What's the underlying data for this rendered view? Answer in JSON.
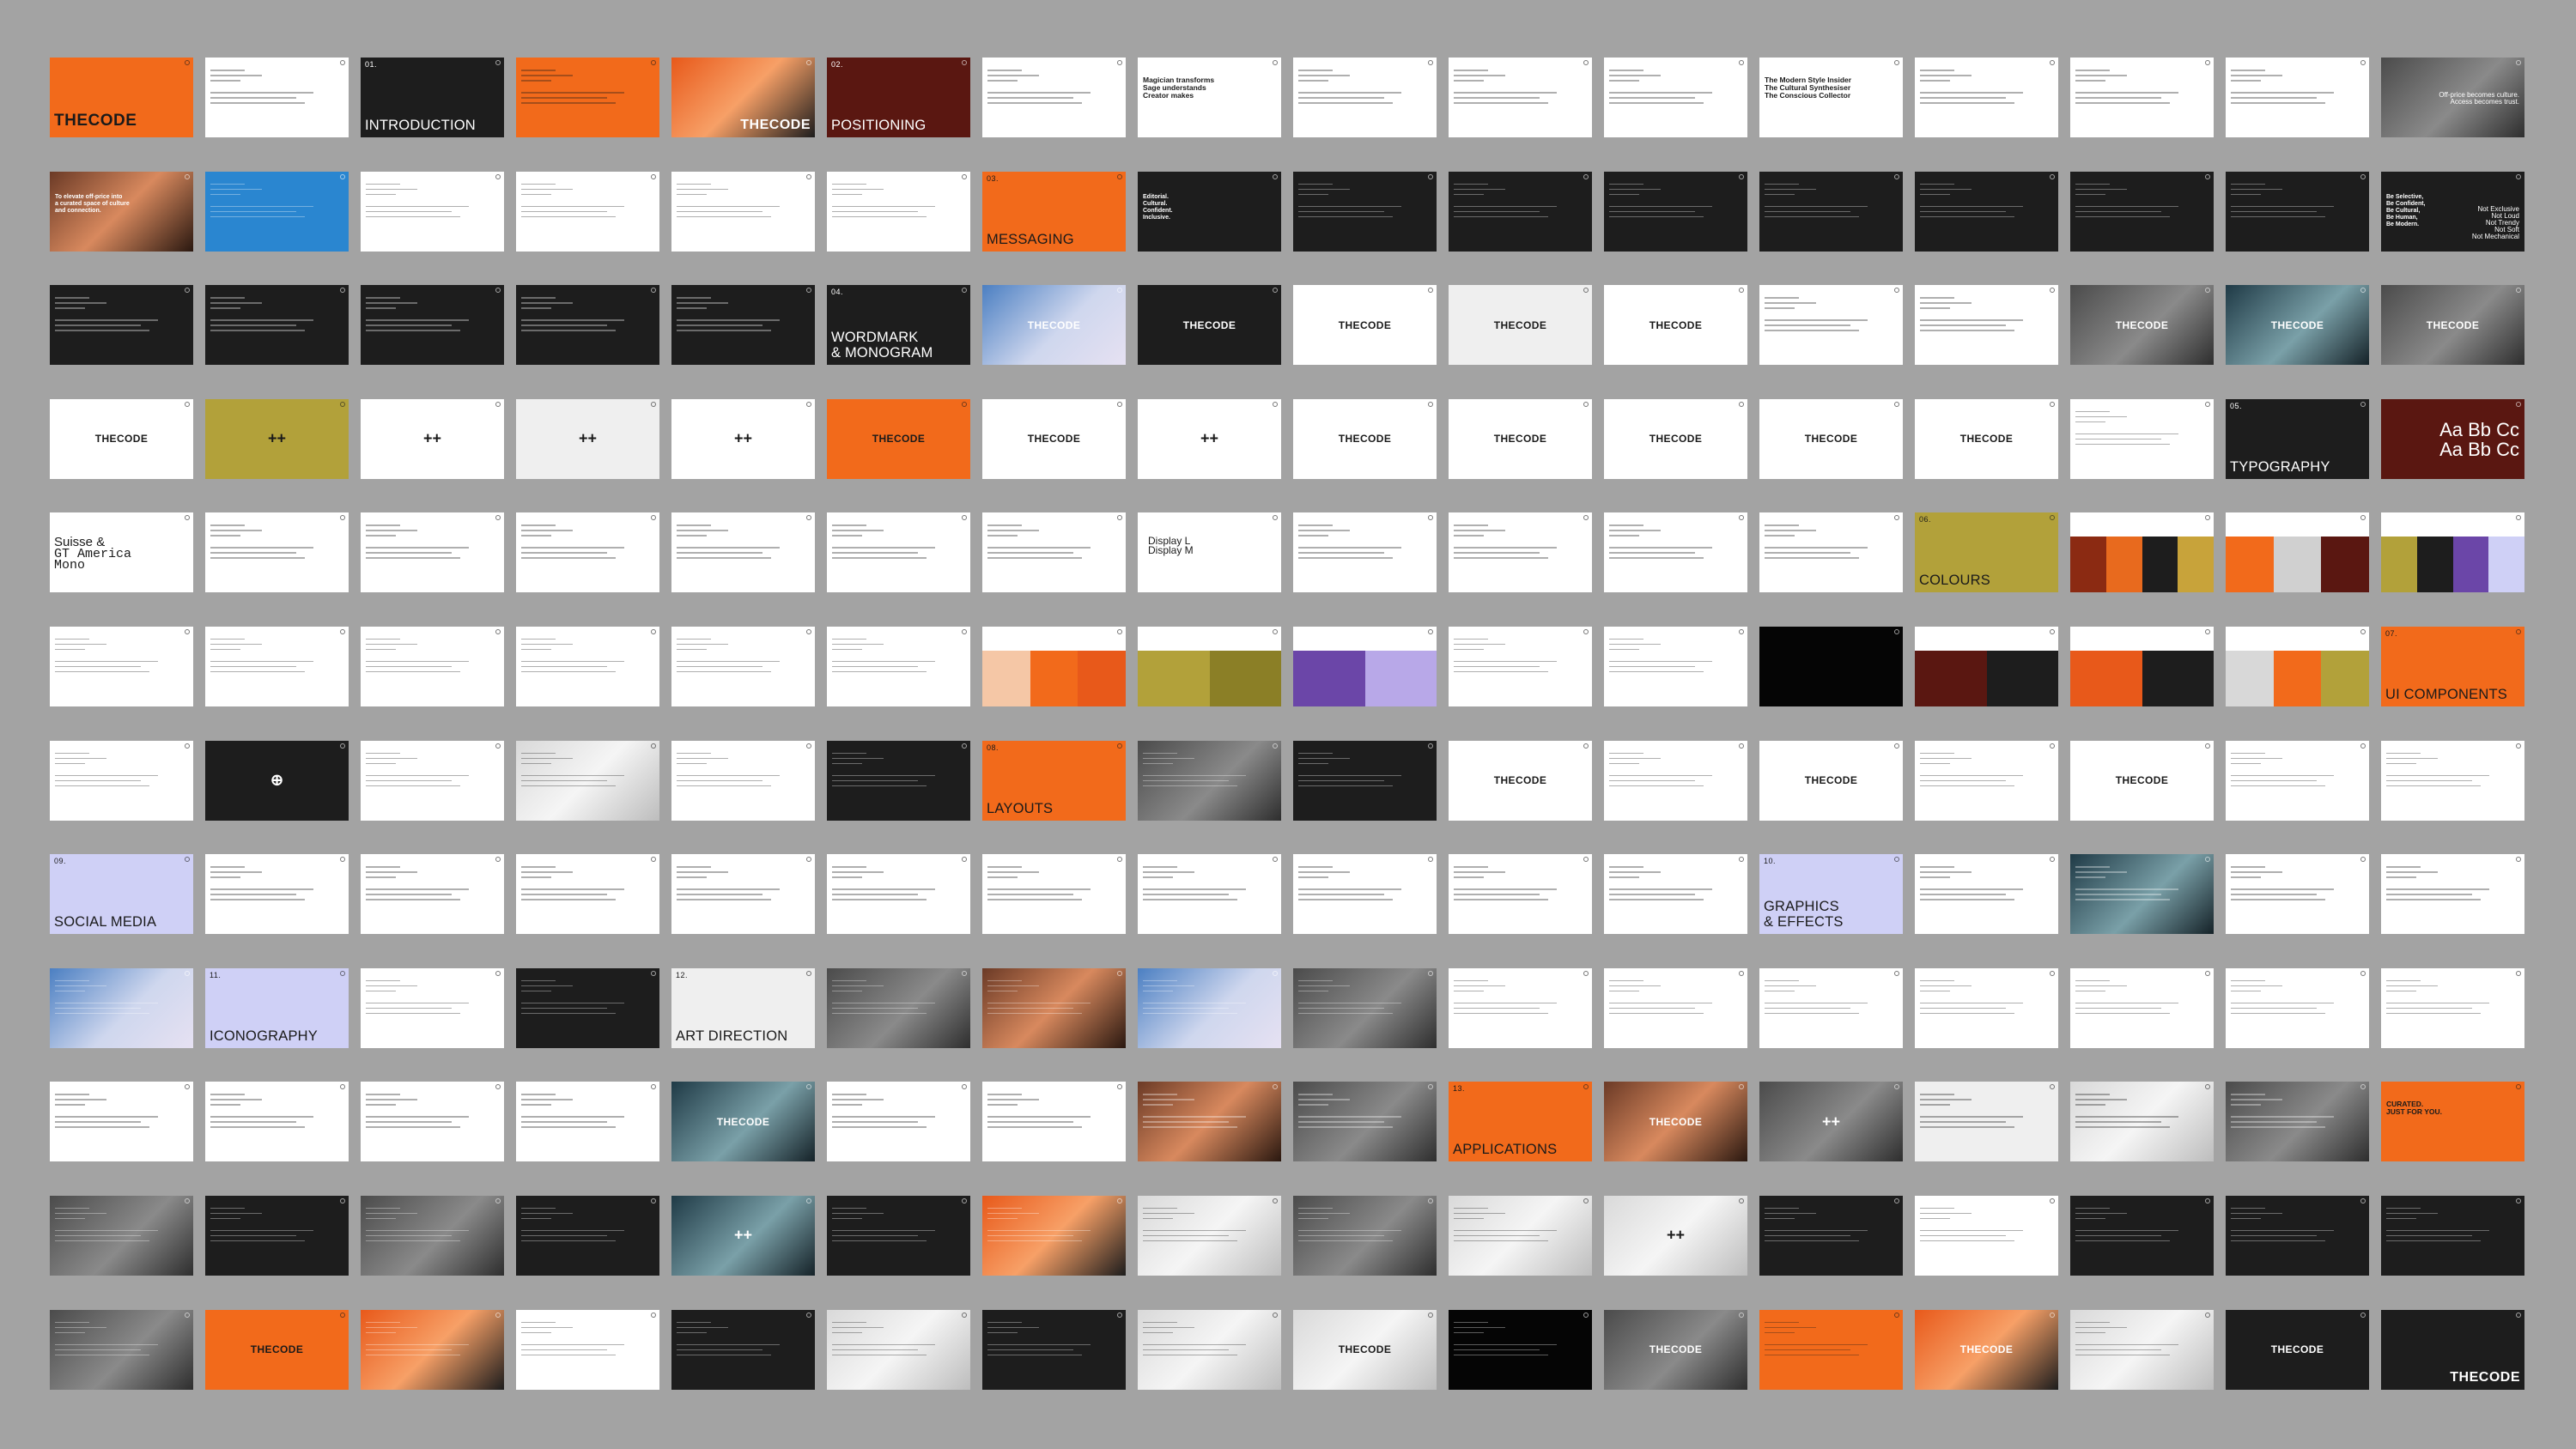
{
  "colors": {
    "background": "#a3a3a3",
    "orange": "#f26a1b",
    "dark": "#1d1d1d",
    "maroon": "#5a1711",
    "lilac": "#cfd0f6",
    "olive": "#b2a13a"
  },
  "slides": [
    {
      "kind": "orange",
      "brand": "THECODE"
    },
    {
      "kind": "white",
      "lines": true
    },
    {
      "kind": "dark",
      "num": "01.",
      "label": "INTRODUCTION"
    },
    {
      "kind": "orange",
      "lines": true
    },
    {
      "kind": "photo-orange",
      "brandbr": "THECODE"
    },
    {
      "kind": "maroon",
      "num": "02.",
      "label": "POSITIONING"
    },
    {
      "kind": "white",
      "lines": true
    },
    {
      "kind": "white",
      "headline": "Magician transforms\nSage understands\nCreator makes"
    },
    {
      "kind": "white",
      "lines": true
    },
    {
      "kind": "white",
      "lines": true
    },
    {
      "kind": "white",
      "lines": true
    },
    {
      "kind": "white",
      "headline": "The Modern Style Insider\nThe Cultural Synthesiser\nThe Conscious Collector"
    },
    {
      "kind": "white",
      "lines": true
    },
    {
      "kind": "white",
      "lines": true
    },
    {
      "kind": "white",
      "lines": true
    },
    {
      "kind": "photo",
      "rtext": "Off-price becomes culture.\nAccess becomes trust."
    },
    {
      "kind": "photo-warm",
      "headlineW": "To elevate off-price into\na curated space of culture\nand connection."
    },
    {
      "kind": "blue",
      "lines": true
    },
    {
      "kind": "white",
      "lines": true
    },
    {
      "kind": "white",
      "lines": true
    },
    {
      "kind": "white",
      "lines": true
    },
    {
      "kind": "white",
      "lines": true
    },
    {
      "kind": "orange",
      "num": "03.",
      "label": "MESSAGING"
    },
    {
      "kind": "dark",
      "headlineW": "Editorial.\nCultural.\nConfident.\nInclusive."
    },
    {
      "kind": "dark",
      "lines": true
    },
    {
      "kind": "dark",
      "lines": true
    },
    {
      "kind": "dark",
      "lines": true
    },
    {
      "kind": "dark",
      "lines": true
    },
    {
      "kind": "dark",
      "lines": true
    },
    {
      "kind": "dark",
      "lines": true
    },
    {
      "kind": "dark",
      "lines": true
    },
    {
      "kind": "dark",
      "headlineW": "Be Selective,\nBe Confident,\nBe Cultural,\nBe Human,\nBe Modern.",
      "rtext": "Not Exclusive\nNot Loud\nNot Trendy\nNot Soft\nNot Mechanical"
    },
    {
      "kind": "dark",
      "lines": true
    },
    {
      "kind": "dark",
      "lines": true
    },
    {
      "kind": "dark",
      "lines": true
    },
    {
      "kind": "dark",
      "lines": true
    },
    {
      "kind": "dark",
      "lines": true
    },
    {
      "kind": "dark",
      "num": "04.",
      "label": "WORDMARK\n& MONOGRAM"
    },
    {
      "kind": "photo-blue",
      "brandsm": "THECODE"
    },
    {
      "kind": "dark",
      "brandsm": "THECODE"
    },
    {
      "kind": "white",
      "brandsm": "THECODE"
    },
    {
      "kind": "lightgrey",
      "brandsm": "THECODE"
    },
    {
      "kind": "white",
      "brandsm": "THECODE"
    },
    {
      "kind": "white",
      "lines": true
    },
    {
      "kind": "white",
      "lines": true
    },
    {
      "kind": "photo",
      "brandsm": "THECODE"
    },
    {
      "kind": "photo-cool",
      "brandsm": "THECODE"
    },
    {
      "kind": "photo",
      "brandsm": "THECODE"
    },
    {
      "kind": "white",
      "brandsm": "THECODE"
    },
    {
      "kind": "olive",
      "icon": "++"
    },
    {
      "kind": "white",
      "icon": "++"
    },
    {
      "kind": "lightgrey",
      "icon": "++"
    },
    {
      "kind": "white",
      "icon": "++"
    },
    {
      "kind": "orange",
      "brandsm": "THECODE"
    },
    {
      "kind": "white",
      "brandsm": "THECODE"
    },
    {
      "kind": "white",
      "icon": "++"
    },
    {
      "kind": "white",
      "brandsm": "THECODE"
    },
    {
      "kind": "white",
      "brandsm": "THECODE"
    },
    {
      "kind": "white",
      "brandsm": "THECODE"
    },
    {
      "kind": "white",
      "brandsm": "THECODE"
    },
    {
      "kind": "white",
      "brandsm": "THECODE"
    },
    {
      "kind": "white",
      "lines": true
    },
    {
      "kind": "dark",
      "num": "05.",
      "label": "TYPOGRAPHY"
    },
    {
      "kind": "maroon",
      "typeR": "Aa Bb Cc\nAa  Bb  Cc"
    },
    {
      "kind": "white",
      "typeL": "Suisse &",
      "typeMono": "GT America\nMono"
    },
    {
      "kind": "white",
      "lines": true
    },
    {
      "kind": "white",
      "lines": true
    },
    {
      "kind": "white",
      "lines": true
    },
    {
      "kind": "white",
      "lines": true
    },
    {
      "kind": "white",
      "lines": true
    },
    {
      "kind": "white",
      "lines": true
    },
    {
      "kind": "white",
      "display": "Display L\nDisplay M"
    },
    {
      "kind": "white",
      "lines": true
    },
    {
      "kind": "white",
      "lines": true
    },
    {
      "kind": "white",
      "lines": true
    },
    {
      "kind": "white",
      "lines": true
    },
    {
      "kind": "olive",
      "num": "06.",
      "label": "COLOURS"
    },
    {
      "kind": "white",
      "blocks": [
        "#8b2a12",
        "#e86a1e",
        "#1d1d1d",
        "#c8a33a"
      ]
    },
    {
      "kind": "white",
      "blocks": [
        "#f26a1b",
        "#d0d0d0",
        "#5a1711"
      ]
    },
    {
      "kind": "white",
      "blocks": [
        "#b2a13a",
        "#1d1d1d",
        "#6b46a8",
        "#cfd0f6"
      ]
    },
    {
      "kind": "white",
      "lines": true
    },
    {
      "kind": "white",
      "lines": true
    },
    {
      "kind": "white",
      "lines": true
    },
    {
      "kind": "white",
      "lines": true
    },
    {
      "kind": "white",
      "lines": true
    },
    {
      "kind": "white",
      "lines": true
    },
    {
      "kind": "white",
      "blocks": [
        "#f5c7a6",
        "#f26a1b",
        "#e8591a"
      ]
    },
    {
      "kind": "white",
      "blocks": [
        "#b2a13a",
        "#8b7f26"
      ]
    },
    {
      "kind": "white",
      "blocks": [
        "#6b46a8",
        "#b8a8e8"
      ]
    },
    {
      "kind": "white",
      "lines": true
    },
    {
      "kind": "white",
      "lines": true
    },
    {
      "kind": "black"
    },
    {
      "kind": "white",
      "blocks": [
        "#5a1711",
        "#1d1d1d"
      ]
    },
    {
      "kind": "white",
      "blocks": [
        "#e8591a",
        "#1d1d1d"
      ]
    },
    {
      "kind": "white",
      "blocks": [
        "#d8d8d8",
        "#f26a1b",
        "#b2a13a"
      ]
    },
    {
      "kind": "orange",
      "num": "07.",
      "label": "UI COMPONENTS"
    },
    {
      "kind": "white",
      "lines": true
    },
    {
      "kind": "dark",
      "icon": "⊕"
    },
    {
      "kind": "white",
      "lines": true
    },
    {
      "kind": "photo-light",
      "lines": true
    },
    {
      "kind": "white",
      "lines": true
    },
    {
      "kind": "dark",
      "lines": true
    },
    {
      "kind": "orange",
      "num": "08.",
      "label": "LAYOUTS"
    },
    {
      "kind": "photo",
      "lines": true
    },
    {
      "kind": "dark",
      "lines": true
    },
    {
      "kind": "white",
      "brandsm": "THECODE"
    },
    {
      "kind": "white",
      "lines": true
    },
    {
      "kind": "white",
      "brandsm": "THECODE"
    },
    {
      "kind": "white",
      "lines": true
    },
    {
      "kind": "white",
      "brandsm": "THECODE"
    },
    {
      "kind": "white",
      "lines": true
    },
    {
      "kind": "white",
      "lines": true
    },
    {
      "kind": "lilac",
      "num": "09.",
      "label": "SOCIAL MEDIA"
    },
    {
      "kind": "white",
      "lines": true
    },
    {
      "kind": "white",
      "lines": true
    },
    {
      "kind": "white",
      "lines": true
    },
    {
      "kind": "white",
      "lines": true
    },
    {
      "kind": "white",
      "lines": true
    },
    {
      "kind": "white",
      "lines": true
    },
    {
      "kind": "white",
      "lines": true
    },
    {
      "kind": "white",
      "lines": true
    },
    {
      "kind": "white",
      "lines": true
    },
    {
      "kind": "white",
      "lines": true
    },
    {
      "kind": "lilac",
      "num": "10.",
      "label": "GRAPHICS\n& EFFECTS"
    },
    {
      "kind": "white",
      "lines": true
    },
    {
      "kind": "photo-cool",
      "lines": true
    },
    {
      "kind": "white",
      "lines": true
    },
    {
      "kind": "white",
      "lines": true
    },
    {
      "kind": "photo-blue",
      "lines": true
    },
    {
      "kind": "lilac",
      "num": "11.",
      "label": "ICONOGRAPHY"
    },
    {
      "kind": "white",
      "lines": true
    },
    {
      "kind": "dark",
      "lines": true
    },
    {
      "kind": "lightgrey",
      "num": "12.",
      "label": "ART DIRECTION"
    },
    {
      "kind": "photo",
      "lines": true
    },
    {
      "kind": "photo-warm",
      "lines": true
    },
    {
      "kind": "photo-blue",
      "lines": true
    },
    {
      "kind": "photo",
      "lines": true
    },
    {
      "kind": "white",
      "lines": true
    },
    {
      "kind": "white",
      "lines": true
    },
    {
      "kind": "white",
      "lines": true
    },
    {
      "kind": "white",
      "lines": true
    },
    {
      "kind": "white",
      "lines": true
    },
    {
      "kind": "white",
      "lines": true
    },
    {
      "kind": "white",
      "lines": true
    },
    {
      "kind": "white",
      "lines": true
    },
    {
      "kind": "white",
      "lines": true
    },
    {
      "kind": "white",
      "lines": true
    },
    {
      "kind": "white",
      "lines": true
    },
    {
      "kind": "photo-cool",
      "brandsm": "THECODE"
    },
    {
      "kind": "white",
      "lines": true
    },
    {
      "kind": "white",
      "lines": true
    },
    {
      "kind": "photo-warm",
      "lines": true
    },
    {
      "kind": "photo",
      "lines": true
    },
    {
      "kind": "orange",
      "num": "13.",
      "label": "APPLICATIONS"
    },
    {
      "kind": "photo-warm",
      "brandsm": "THECODE"
    },
    {
      "kind": "photo",
      "icon": "++"
    },
    {
      "kind": "lightgrey",
      "lines": true
    },
    {
      "kind": "photo-light",
      "lines": true
    },
    {
      "kind": "photo",
      "lines": true
    },
    {
      "kind": "orange",
      "headline": "CURATED.\nJUST FOR YOU."
    },
    {
      "kind": "photo",
      "lines": true
    },
    {
      "kind": "dark",
      "lines": true
    },
    {
      "kind": "photo",
      "lines": true
    },
    {
      "kind": "dark",
      "lines": true
    },
    {
      "kind": "photo-cool",
      "icon": "++"
    },
    {
      "kind": "dark",
      "lines": true
    },
    {
      "kind": "photo-orange",
      "lines": true
    },
    {
      "kind": "photo-light",
      "lines": true
    },
    {
      "kind": "photo",
      "lines": true
    },
    {
      "kind": "photo-light",
      "lines": true
    },
    {
      "kind": "photo-light",
      "icon": "++"
    },
    {
      "kind": "dark",
      "lines": true
    },
    {
      "kind": "white",
      "lines": true
    },
    {
      "kind": "dark",
      "lines": true
    },
    {
      "kind": "dark",
      "lines": true
    },
    {
      "kind": "dark",
      "lines": true
    },
    {
      "kind": "photo",
      "lines": true
    },
    {
      "kind": "orange",
      "brandsm": "THECODE"
    },
    {
      "kind": "photo-orange",
      "lines": true
    },
    {
      "kind": "white",
      "lines": true
    },
    {
      "kind": "dark",
      "lines": true
    },
    {
      "kind": "photo-light",
      "lines": true
    },
    {
      "kind": "dark",
      "lines": true
    },
    {
      "kind": "photo-light",
      "lines": true
    },
    {
      "kind": "photo-light",
      "brandsm": "THECODE"
    },
    {
      "kind": "black",
      "lines": true
    },
    {
      "kind": "photo",
      "brandsm": "THECODE"
    },
    {
      "kind": "orange",
      "lines": true
    },
    {
      "kind": "photo-orange",
      "brandsm": "THECODE"
    },
    {
      "kind": "photo-light",
      "lines": true
    },
    {
      "kind": "dark",
      "brandsm": "THECODE"
    },
    {
      "kind": "dark",
      "brandbr": "THECODE"
    }
  ]
}
